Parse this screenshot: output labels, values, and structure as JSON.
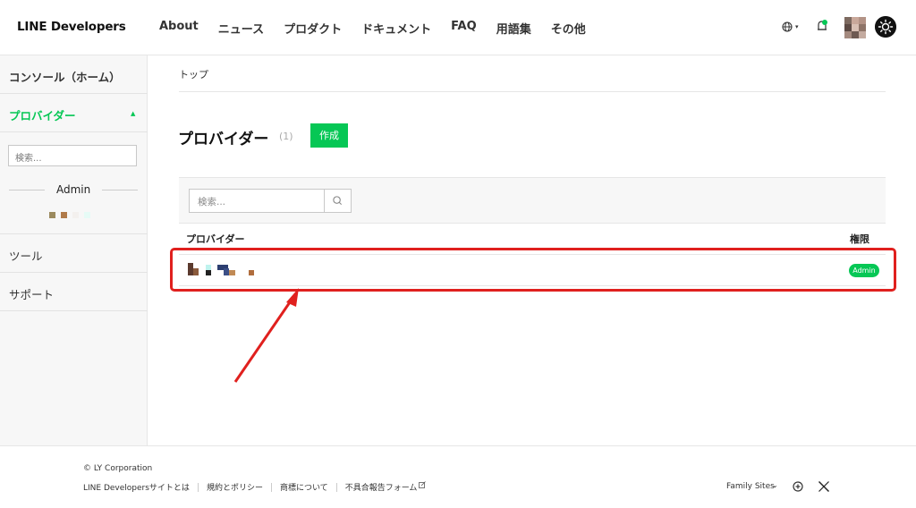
{
  "header": {
    "logo": "LINE Developers",
    "nav": [
      "About",
      "ニュース",
      "プロダクト",
      "ドキュメント",
      "FAQ",
      "用語集",
      "その他"
    ],
    "icons": [
      "globe-icon",
      "bell-icon",
      "avatar",
      "theme-toggle-icon"
    ]
  },
  "sidebar": {
    "console": "コンソール（ホーム）",
    "provider": "プロバイダー",
    "search_placeholder": "検索...",
    "role": "Admin",
    "tools": "ツール",
    "support": "サポート"
  },
  "main": {
    "breadcrumb": "トップ",
    "title": "プロバイダー",
    "count": "(1)",
    "create_label": "作成",
    "search_placeholder": "検索...",
    "columns": [
      "プロバイダー",
      "権限"
    ],
    "rows": [
      {
        "provider": "",
        "permission": "Admin"
      }
    ]
  },
  "footer": {
    "copyright": "© LY Corporation",
    "links": [
      "LINE Developersサイトとは",
      "規約とポリシー",
      "商標について",
      "不具合報告フォーム"
    ],
    "family_sites": "Family Sites"
  },
  "colors": {
    "accent": "#06c755",
    "highlight": "#e0201e"
  }
}
